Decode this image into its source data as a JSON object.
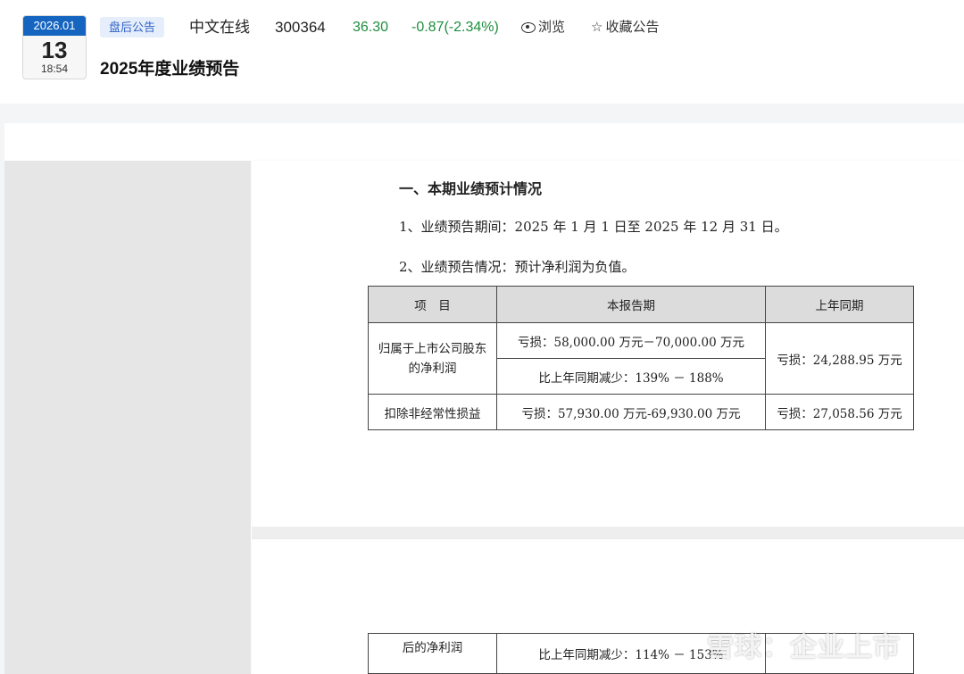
{
  "header": {
    "date_card": {
      "year_month": "2026.01",
      "day": "13",
      "time": "18:54"
    },
    "tag": "盘后公告",
    "company": "中文在线",
    "code": "300364",
    "price": "36.30",
    "change": "-0.87(-2.34%)",
    "browse_label": "浏览",
    "favorite_label": "收藏公告",
    "title": "2025年度业绩预告"
  },
  "document": {
    "section_heading": "一、本期业绩预计情况",
    "para1": "1、业绩预告期间：2025 年 1 月 1 日至 2025 年 12 月 31 日。",
    "para2": "2、业绩预告情况：预计净利润为负值。",
    "table": {
      "headers": [
        "项　目",
        "本报告期",
        "上年同期"
      ],
      "row1_label": "归属于上市公司股东的净利润",
      "row1_current_a": "亏损：58,000.00 万元－70,000.00 万元",
      "row1_current_b": "比上年同期减少：139% － 188%",
      "row1_prior": "亏损：24,288.95 万元",
      "row2_label": "扣除非经常性损益",
      "row2_current": "亏损：57,930.00 万元-69,930.00 万元",
      "row2_prior": "亏损：27,058.56 万元"
    },
    "page2_table": {
      "label": "后的净利润",
      "current": "比上年同期减少：114% － 153%"
    }
  },
  "watermark": "雪球：企业上市",
  "colors": {
    "accent": "#1565c0",
    "down": "#1e8e3e",
    "tag_bg": "#e6eefb"
  }
}
